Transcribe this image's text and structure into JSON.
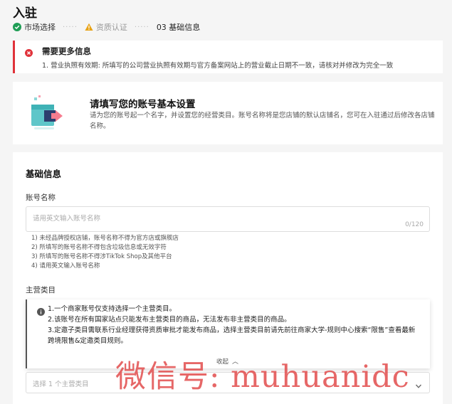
{
  "page": {
    "title": "入驻"
  },
  "steps": [
    {
      "label": "市场选择",
      "state": "done",
      "icon": "check-circle-icon"
    },
    {
      "label": "资质认证",
      "state": "warning",
      "icon": "warning-triangle-icon"
    },
    {
      "label": "03 基础信息",
      "state": "current"
    }
  ],
  "step_separator": "·····",
  "alert": {
    "icon": "error-circle-icon",
    "title": "需要更多信息",
    "body": "1. 营业执照有效期: 所填写的公司营业执照有效期与官方备案网站上的营业截止日期不一致，请核对并修改为完全一致"
  },
  "intro": {
    "title": "请填写您的账号基本设置",
    "description": "请为您的账号起一个名字，并设置您的经营类目。账号名称将是您店铺的默认店铺名，您可在入驻通过后修改各店铺名称。"
  },
  "form": {
    "section_title": "基础信息",
    "account_name": {
      "label": "账号名称",
      "placeholder": "请用英文输入账号名称",
      "counter": "0/120",
      "hints": [
        "1) 未经品牌授权店铺，账号名称不得为官方店或旗舰店",
        "2) 所填写的账号名称不得包含垃圾信息或无效字符",
        "3) 所填写的账号名称不得涉TikTok Shop及其他平台",
        "4) 请用英文输入账号名称"
      ]
    },
    "main_category": {
      "label": "主营类目",
      "notice_icon": "info-circle-icon",
      "notice_lines": [
        "1.一个商家账号仅支持选择一个主营类目。",
        "2.该账号在所有国家站点只能发布主营类目的商品，无法发布非主营类目的商品。",
        "3.定邀子类目需联系行业经理获得资质审批才能发布商品，选择主营类目前请先前往商家大学-规则中心搜索“限售”查看最新跨境限售&定邀类目规则。"
      ],
      "collapse_label": "收起",
      "select_placeholder": "选择 1 个主营类目"
    }
  },
  "watermark": "微信号: muhuanidc",
  "colors": {
    "success": "#1f9d55",
    "warning": "#e8a317",
    "error": "#e0323a",
    "watermark": "#e24c4c"
  }
}
